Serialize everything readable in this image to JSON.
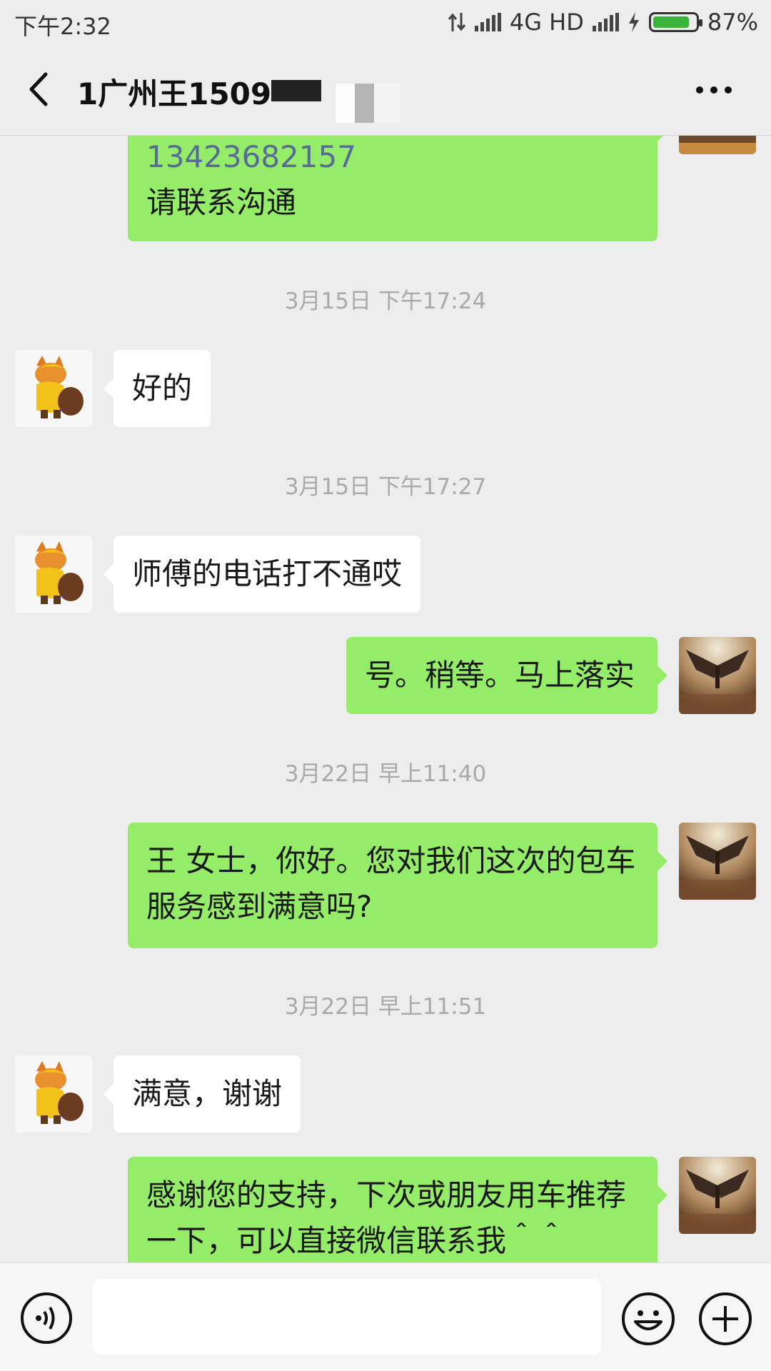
{
  "status_bar": {
    "time": "下午2:32",
    "network": "4G HD",
    "battery": "87%",
    "battery_level": 0.87
  },
  "header": {
    "title": "1广州王1509",
    "back_icon": "chevron-left-icon",
    "more_icon": "more-dots-icon"
  },
  "messages": {
    "m1_phone": "13423682157",
    "m1_text": "请联系沟通",
    "ts1": "3月15日 下午17:24",
    "m2": "好的",
    "ts2": "3月15日 下午17:27",
    "m3": "师傅的电话打不通哎",
    "m4": "号。稍等。马上落实",
    "ts3": "3月22日 早上11:40",
    "m5": "王 女士，你好。您对我们这次的包车服务感到满意吗?",
    "ts4": "3月22日 早上11:51",
    "m6": "满意，谢谢",
    "m7": "感谢您的支持，下次或朋友用车推荐一下，可以直接微信联系我＾＾"
  },
  "input_bar": {
    "voice_icon": "voice-icon",
    "emoji_icon": "emoji-icon",
    "plus_icon": "plus-icon"
  },
  "colors": {
    "outgoing_bubble": "#95ec69",
    "incoming_bubble": "#ffffff",
    "background": "#ededed",
    "link": "#576b95"
  }
}
